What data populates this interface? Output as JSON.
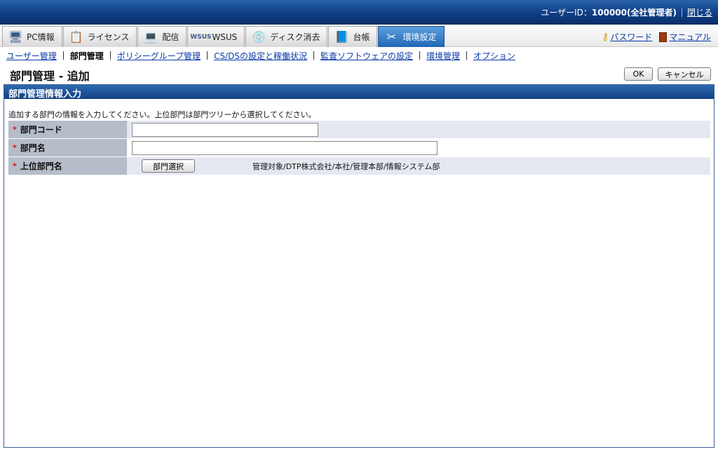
{
  "header": {
    "user_label": "ユーザーID：",
    "user_value": "100000(全社管理者)",
    "close_label": "閉じる"
  },
  "tabs": [
    {
      "label": "PC情報",
      "icon": "pc-icon"
    },
    {
      "label": "ライセンス",
      "icon": "license-icon"
    },
    {
      "label": "配信",
      "icon": "delivery-icon"
    },
    {
      "label": "WSUS",
      "icon": "wsus-icon",
      "icon_text": "WSUS"
    },
    {
      "label": "ディスク消去",
      "icon": "disk-erase-icon"
    },
    {
      "label": "台帳",
      "icon": "ledger-icon"
    },
    {
      "label": "環境設定",
      "icon": "settings-tools-icon",
      "active": true
    }
  ],
  "toplinks": {
    "password": "パスワード",
    "manual": "マニュアル"
  },
  "subnav": {
    "items": [
      {
        "label": "ユーザー管理",
        "current": false
      },
      {
        "label": "部門管理",
        "current": true
      },
      {
        "label": "ポリシーグループ管理",
        "current": false
      },
      {
        "label": "CS/DSの設定と稼働状況",
        "current": false
      },
      {
        "label": "監査ソフトウェアの設定",
        "current": false
      },
      {
        "label": "環境管理",
        "current": false
      },
      {
        "label": "オプション",
        "current": false
      }
    ]
  },
  "page": {
    "title": "部門管理 - 追加",
    "ok_label": "OK",
    "cancel_label": "キャンセル"
  },
  "section": {
    "title": "部門管理情報入力",
    "instruction": "追加する部門の情報を入力してください。上位部門は部門ツリーから選択してください。"
  },
  "form": {
    "required_mark": "*",
    "dept_code_label": "部門コード",
    "dept_code_value": "",
    "dept_name_label": "部門名",
    "dept_name_value": "",
    "parent_label": "上位部門名",
    "select_button": "部門選択",
    "parent_path": "管理対象/DTP株式会社/本社/管理本部/情報システム部"
  },
  "colors": {
    "header_blue": "#0f3f86",
    "active_tab": "#1f66b5",
    "link": "#0a3aa8",
    "label_bg": "#b5bdc9",
    "value_bg": "#e4e9f1",
    "required": "#dd1111"
  }
}
